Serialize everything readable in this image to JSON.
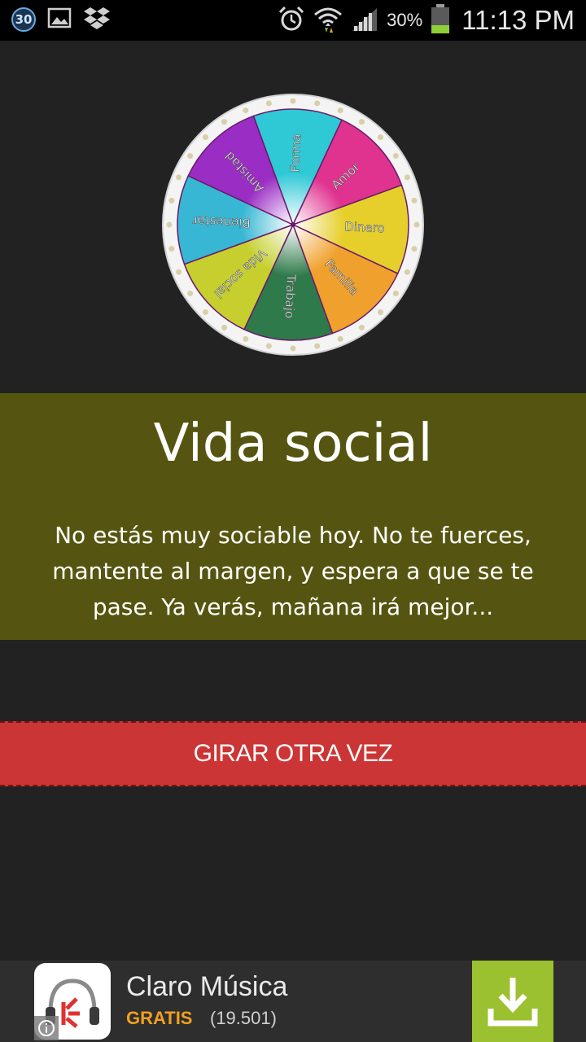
{
  "status_bar": {
    "notification_count": "30",
    "battery_percent": "30%",
    "time": "11:13 PM",
    "icons": [
      "gallery-icon",
      "dropbox-icon",
      "alarm-icon",
      "wifi-icon",
      "signal-icon",
      "battery-icon"
    ]
  },
  "wheel": {
    "segments": [
      {
        "label": "Forma",
        "color": "#2fc9d6"
      },
      {
        "label": "Amor",
        "color": "#e0338f"
      },
      {
        "label": "Dinero",
        "color": "#e6cf2a"
      },
      {
        "label": "Familia",
        "color": "#f0a02c"
      },
      {
        "label": "Trabajo",
        "color": "#2f7a4a"
      },
      {
        "label": "Vida social",
        "color": "#c6cf2e"
      },
      {
        "label": "Bienestar",
        "color": "#37b7d4"
      },
      {
        "label": "Amistad",
        "color": "#9a2dc4"
      }
    ]
  },
  "result": {
    "title": "Vida social",
    "text": "No estás muy sociable hoy. No te fuerces, mantente al margen, y espera a que se te pase. Ya verás, mañana irá mejor...",
    "background": "#555511"
  },
  "spin_button": {
    "label": "GIRAR OTRA VEZ",
    "color": "#cc3535"
  },
  "ad": {
    "app_name": "Claro Música",
    "price": "GRATIS",
    "reviews": "(19.501)",
    "download_color": "#9cc130"
  }
}
